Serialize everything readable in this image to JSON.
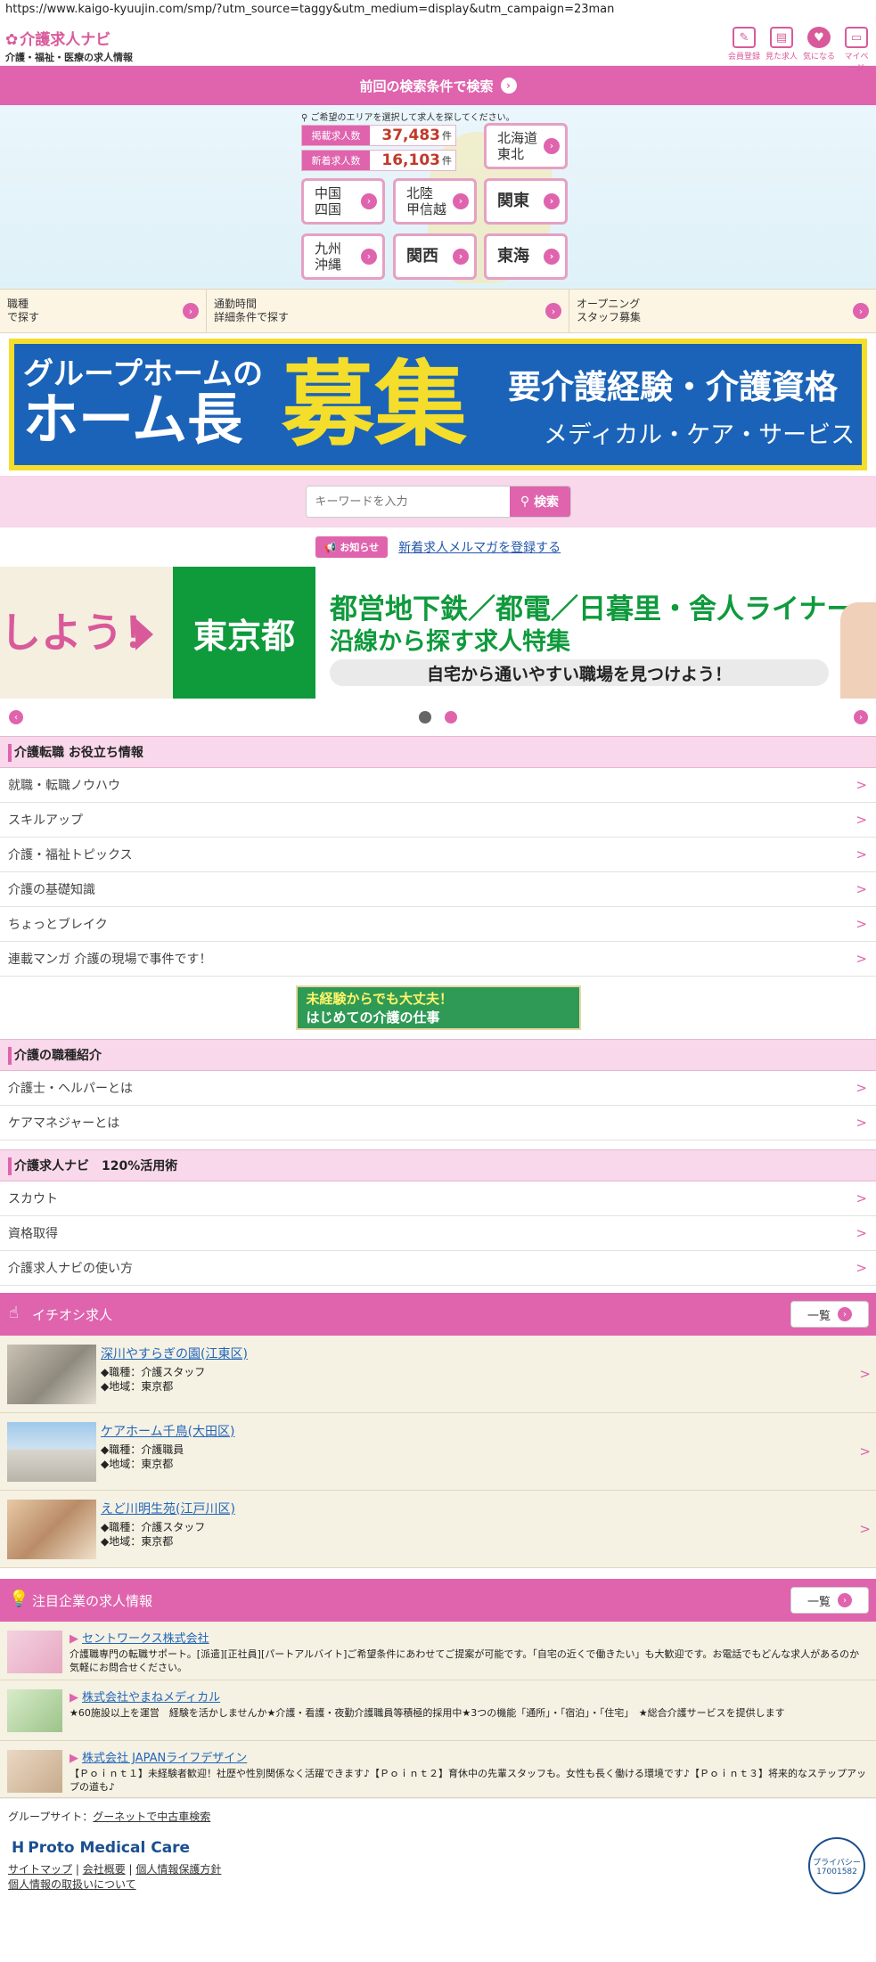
{
  "url": "https://www.kaigo-kyuujin.com/smp/?utm_source=taggy&utm_medium=display&utm_campaign=23man",
  "header": {
    "logo_main": "介護求人",
    "logo_navi": "ナビ",
    "logo_sub": "介護・福祉・医療の求人情報",
    "icons": [
      {
        "label": "会員登録",
        "glyph": "✎"
      },
      {
        "label": "見た求人",
        "glyph": "▤"
      },
      {
        "label": "気になる",
        "glyph": "♥"
      },
      {
        "label": "マイページ",
        "glyph": "▭"
      }
    ]
  },
  "prev_search": "前回の検索条件で検索",
  "area": {
    "guide": "ご希望のエリアを選択して求人を探してください。",
    "counters": [
      {
        "label": "掲載求人数",
        "value": "37,483",
        "unit": "件"
      },
      {
        "label": "新着求人数",
        "value": "16,103",
        "unit": "件"
      }
    ],
    "regions": [
      "北海道\n東北",
      "中国\n四国",
      "北陸\n甲信越",
      "関東",
      "九州\n沖縄",
      "関西",
      "東海"
    ]
  },
  "search_tabs": [
    {
      "line1": "職種",
      "line2": "で探す"
    },
    {
      "line1": "通勤時間",
      "line2": "詳細条件で探す"
    },
    {
      "line1": "オープニング",
      "line2": "スタッフ募集"
    }
  ],
  "banner1": {
    "a": "グループホームの",
    "b": "ホーム長",
    "c": "募集",
    "d": "要介護経験・介護資格",
    "e": "メディカル・ケア・サービス"
  },
  "keyword": {
    "placeholder": "キーワードを入力",
    "button": "検索"
  },
  "notice": {
    "tag": "お知らせ",
    "link": "新着求人メルマガを登録する"
  },
  "slide": {
    "left_text": "しよう！",
    "green": "東京都",
    "t1": "都営地下鉄／都電／日暮里・舎人ライナー",
    "t2": "沿線から探す求人特集",
    "t3": "自宅から通いやすい職場を見つけよう！"
  },
  "sections": {
    "tips": {
      "title": "介護転職 お役立ち情報",
      "items": [
        "就職・転職ノウハウ",
        "スキルアップ",
        "介護・福祉トピックス",
        "介護の基礎知識",
        "ちょっとブレイク",
        "連載マンガ 介護の現場で事件です！"
      ]
    },
    "mini_banner": {
      "m1": "未経験からでも大丈夫！",
      "m2": "はじめての介護の仕事"
    },
    "jobtypes": {
      "title": "介護の職種紹介",
      "items": [
        "介護士・ヘルパーとは",
        "ケアマネジャーとは"
      ]
    },
    "usage": {
      "title": "介護求人ナビ　120%活用術",
      "items": [
        "スカウト",
        "資格取得",
        "介護求人ナビの使い方"
      ]
    }
  },
  "featured": {
    "title": "イチオシ求人",
    "more": "一覧",
    "jobs": [
      {
        "name": "深川やすらぎの園(江東区)",
        "type": "◆職種：介護スタッフ",
        "area": "◆地域：東京都"
      },
      {
        "name": "ケアホーム千鳥(大田区)",
        "type": "◆職種：介護職員",
        "area": "◆地域：東京都"
      },
      {
        "name": "えど川明生苑(江戸川区)",
        "type": "◆職種：介護スタッフ",
        "area": "◆地域：東京都"
      }
    ]
  },
  "companies": {
    "title": "注目企業の求人情報",
    "more": "一覧",
    "items": [
      {
        "name": "セントワークス株式会社",
        "desc": "介護職専門の転職サポート。[派遣][正社員][パートアルバイト]ご希望条件にあわせてご提案が可能です。「自宅の近くで働きたい」も大歓迎です。お電話でもどんな求人があるのか気軽にお問合せください。"
      },
      {
        "name": "株式会社やまねメディカル",
        "desc": "★60施設以上を運営　経験を活かしませんか★介護・看護・夜勤介護職員等積極的採用中★3つの機能「通所」・「宿泊」・「住宅」　★総合介護サービスを提供します"
      },
      {
        "name": "株式会社 JAPANライフデザイン",
        "desc": "【Ｐｏｉｎｔ１】未経験者歓迎！社歴や性別関係なく活躍できます♪【Ｐｏｉｎｔ２】育休中の先輩スタッフも。女性も長く働ける環境です♪【Ｐｏｉｎｔ３】将来的なステップアップの道も♪"
      }
    ]
  },
  "footer": {
    "group_label": "グループサイト：",
    "group_link": "グーネットで中古車検索",
    "brand": "Proto Medical Care",
    "links": [
      "サイトマップ",
      "会社概要",
      "個人情報保護方針",
      "個人情報の取扱いについて"
    ],
    "privacy_mark": "プライバシー",
    "privacy_no": "17001582"
  },
  "colors": {
    "accent": "#df64ad",
    "link": "#2266bb",
    "count": "#c0392b"
  }
}
